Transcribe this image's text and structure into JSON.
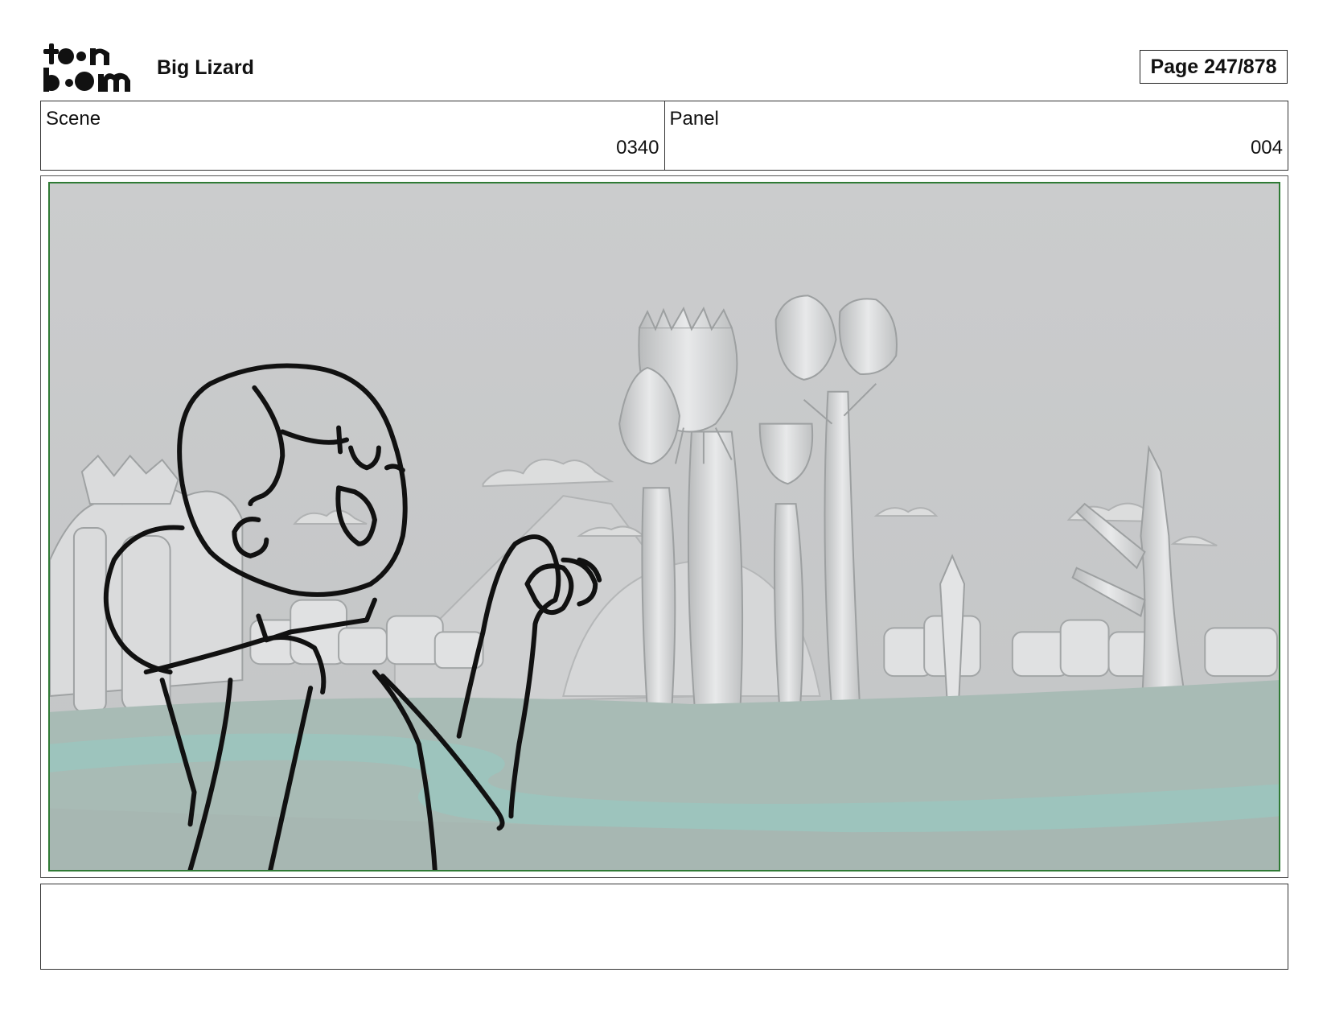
{
  "header": {
    "logo_text": "toon boom",
    "project_title": "Big Lizard",
    "page_label": "Page 247/878"
  },
  "info": {
    "scene_label": "Scene",
    "scene_value": "0340",
    "panel_label": "Panel",
    "panel_value": "004"
  },
  "colors": {
    "frame_border": "#2f7a35",
    "sky": "#c9cacb",
    "ground": "#a6bdb6",
    "water": "#9cc6bf"
  },
  "notes": {
    "text": ""
  }
}
